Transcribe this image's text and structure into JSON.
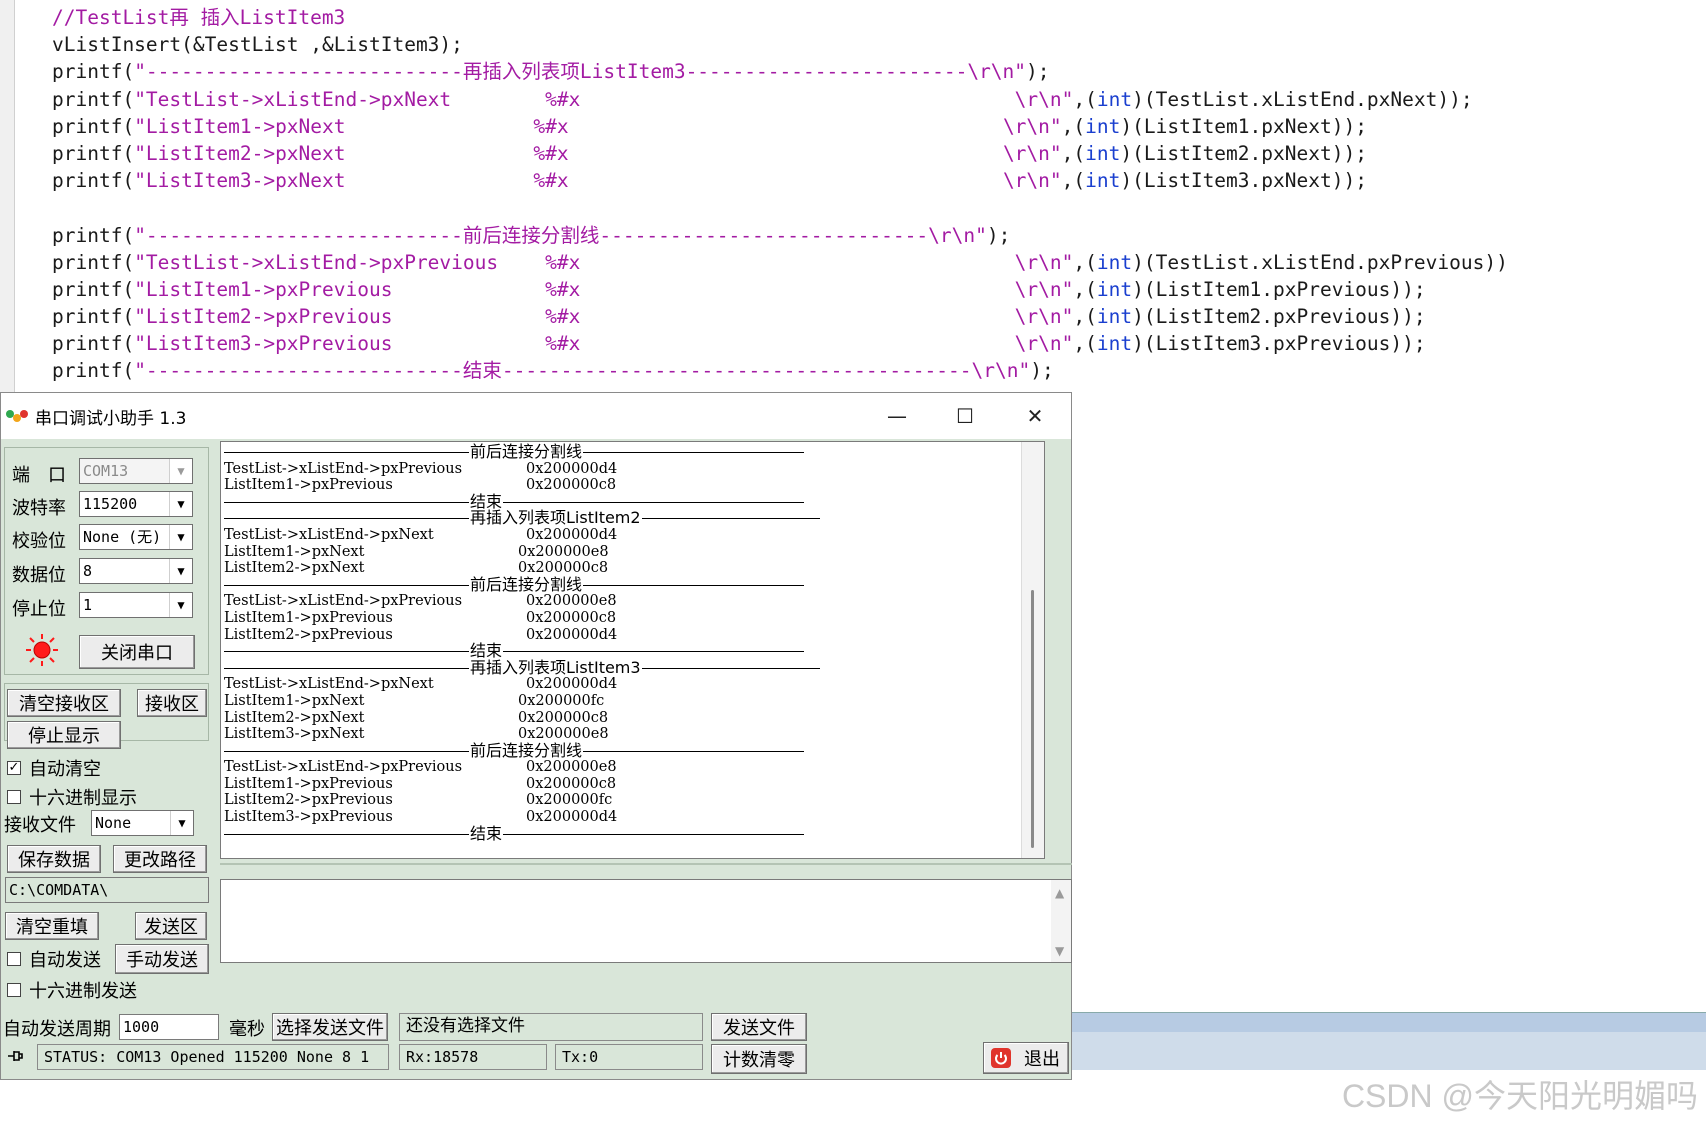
{
  "editor": {
    "lines": [
      {
        "parts": [
          {
            "c": "cm",
            "t": "//TestList再 插入ListItem3"
          }
        ]
      },
      {
        "parts": [
          {
            "c": "",
            "t": "vListInsert(&TestList ,&ListItem3);"
          }
        ]
      },
      {
        "parts": [
          {
            "c": "",
            "t": "printf("
          },
          {
            "c": "str",
            "t": "\"---------------------------再插入列表项ListItem3------------------------\\r\\n\""
          },
          {
            "c": "",
            "t": ");"
          }
        ]
      },
      {
        "parts": [
          {
            "c": "",
            "t": "printf("
          },
          {
            "c": "str",
            "t": "\"TestList->xListEnd->pxNext        %#x                                     \\r\\n\""
          },
          {
            "c": "",
            "t": ","
          },
          {
            "c": "",
            "t": "("
          },
          {
            "c": "kw",
            "t": "int"
          },
          {
            "c": "",
            "t": ")(TestList.xListEnd.pxNext));"
          }
        ]
      },
      {
        "parts": [
          {
            "c": "",
            "t": "printf("
          },
          {
            "c": "str",
            "t": "\"ListItem1->pxNext                %#x                                     \\r\\n\""
          },
          {
            "c": "",
            "t": ","
          },
          {
            "c": "",
            "t": "("
          },
          {
            "c": "kw",
            "t": "int"
          },
          {
            "c": "",
            "t": ")(ListItem1.pxNext));"
          }
        ]
      },
      {
        "parts": [
          {
            "c": "",
            "t": "printf("
          },
          {
            "c": "str",
            "t": "\"ListItem2->pxNext                %#x                                     \\r\\n\""
          },
          {
            "c": "",
            "t": ","
          },
          {
            "c": "",
            "t": "("
          },
          {
            "c": "kw",
            "t": "int"
          },
          {
            "c": "",
            "t": ")(ListItem2.pxNext));"
          }
        ]
      },
      {
        "parts": [
          {
            "c": "",
            "t": "printf("
          },
          {
            "c": "str",
            "t": "\"ListItem3->pxNext                %#x                                     \\r\\n\""
          },
          {
            "c": "",
            "t": ","
          },
          {
            "c": "",
            "t": "("
          },
          {
            "c": "kw",
            "t": "int"
          },
          {
            "c": "",
            "t": ")(ListItem3.pxNext));"
          }
        ]
      },
      {
        "parts": []
      },
      {
        "parts": [
          {
            "c": "",
            "t": "printf("
          },
          {
            "c": "str",
            "t": "\"---------------------------前后连接分割线----------------------------\\r\\n\""
          },
          {
            "c": "",
            "t": ");"
          }
        ]
      },
      {
        "parts": [
          {
            "c": "",
            "t": "printf("
          },
          {
            "c": "str",
            "t": "\"TestList->xListEnd->pxPrevious    %#x                                     \\r\\n\""
          },
          {
            "c": "",
            "t": ","
          },
          {
            "c": "",
            "t": "("
          },
          {
            "c": "kw",
            "t": "int"
          },
          {
            "c": "",
            "t": ")(TestList.xListEnd.pxPrevious))"
          }
        ]
      },
      {
        "parts": [
          {
            "c": "",
            "t": "printf("
          },
          {
            "c": "str",
            "t": "\"ListItem1->pxPrevious             %#x                                     \\r\\n\""
          },
          {
            "c": "",
            "t": ","
          },
          {
            "c": "",
            "t": "("
          },
          {
            "c": "kw",
            "t": "int"
          },
          {
            "c": "",
            "t": ")(ListItem1.pxPrevious));"
          }
        ]
      },
      {
        "parts": [
          {
            "c": "",
            "t": "printf("
          },
          {
            "c": "str",
            "t": "\"ListItem2->pxPrevious             %#x                                     \\r\\n\""
          },
          {
            "c": "",
            "t": ","
          },
          {
            "c": "",
            "t": "("
          },
          {
            "c": "kw",
            "t": "int"
          },
          {
            "c": "",
            "t": ")(ListItem2.pxPrevious));"
          }
        ]
      },
      {
        "parts": [
          {
            "c": "",
            "t": "printf("
          },
          {
            "c": "str",
            "t": "\"ListItem3->pxPrevious             %#x                                     \\r\\n\""
          },
          {
            "c": "",
            "t": ","
          },
          {
            "c": "",
            "t": "("
          },
          {
            "c": "kw",
            "t": "int"
          },
          {
            "c": "",
            "t": ")(ListItem3.pxPrevious));"
          }
        ]
      },
      {
        "parts": [
          {
            "c": "",
            "t": "printf("
          },
          {
            "c": "str",
            "t": "\"---------------------------结束----------------------------------------\\r\\n\""
          },
          {
            "c": "",
            "t": ");"
          }
        ]
      }
    ]
  },
  "window": {
    "title": "串口调试小助手 1.3",
    "minimize": "—",
    "maximize": "☐",
    "close": "✕"
  },
  "settings": {
    "port_label": "端　口",
    "port_value": "COM13",
    "baud_label": "波特率",
    "baud_value": "115200",
    "parity_label": "校验位",
    "parity_value": "None (无)",
    "databits_label": "数据位",
    "databits_value": "8",
    "stopbits_label": "停止位",
    "stopbits_value": "1",
    "close_port": "关闭串口"
  },
  "receive_controls": {
    "clear_receive": "清空接收区",
    "receive_area_label": "接收区",
    "stop_display": "停止显示",
    "auto_clear": "自动清空",
    "auto_clear_checked": "✓",
    "hex_display": "十六进制显示",
    "receive_file_label": "接收文件",
    "receive_file_value": "None",
    "save_data": "保存数据",
    "change_path": "更改路径",
    "path": "C:\\COMDATA\\"
  },
  "send_controls": {
    "clear_refill": "清空重填",
    "send_area_label": "发送区",
    "auto_send": "自动发送",
    "manual_send": "手动发送",
    "hex_send": "十六进制发送",
    "period_label": "自动发送周期",
    "period_value": "1000",
    "ms_label": "毫秒",
    "choose_file": "选择发送文件",
    "file_status": "还没有选择文件",
    "send_file": "发送文件",
    "reset_count": "计数清零",
    "exit": "退出"
  },
  "status": {
    "status_text": "STATUS: COM13 Opened 115200 None  8 1",
    "rx": "Rx:18578",
    "tx": "Tx:0"
  },
  "receive_log": [
    {
      "type": "div",
      "cap": "前后连接分割线",
      "w": 580
    },
    {
      "type": "row",
      "name": "TestList->xListEnd->pxPrevious",
      "val": "0x200000d4"
    },
    {
      "type": "row",
      "name": "ListItem1->pxPrevious",
      "val": "0x200000c8"
    },
    {
      "type": "div",
      "cap": "结束",
      "w": 580
    },
    {
      "type": "div",
      "cap": "再插入列表项ListItem2",
      "w": 596
    },
    {
      "type": "row",
      "name": "TestList->xListEnd->pxNext",
      "val": "0x200000d4"
    },
    {
      "type": "row",
      "name": "ListItem1->pxNext",
      "val": "0x200000e8",
      "alt": true
    },
    {
      "type": "row",
      "name": "ListItem2->pxNext",
      "val": "0x200000c8",
      "alt": true
    },
    {
      "type": "div",
      "cap": "前后连接分割线",
      "w": 580
    },
    {
      "type": "row",
      "name": "TestList->xListEnd->pxPrevious",
      "val": "0x200000e8"
    },
    {
      "type": "row",
      "name": "ListItem1->pxPrevious",
      "val": "0x200000c8"
    },
    {
      "type": "row",
      "name": "ListItem2->pxPrevious",
      "val": "0x200000d4"
    },
    {
      "type": "div",
      "cap": "结束",
      "w": 580
    },
    {
      "type": "div",
      "cap": "再插入列表项ListItem3",
      "w": 596
    },
    {
      "type": "row",
      "name": "TestList->xListEnd->pxNext",
      "val": "0x200000d4"
    },
    {
      "type": "row",
      "name": "ListItem1->pxNext",
      "val": "0x200000fc",
      "alt": true
    },
    {
      "type": "row",
      "name": "ListItem2->pxNext",
      "val": "0x200000c8",
      "alt": true
    },
    {
      "type": "row",
      "name": "ListItem3->pxNext",
      "val": "0x200000e8",
      "alt": true
    },
    {
      "type": "div",
      "cap": "前后连接分割线",
      "w": 580
    },
    {
      "type": "row",
      "name": "TestList->xListEnd->pxPrevious",
      "val": "0x200000e8"
    },
    {
      "type": "row",
      "name": "ListItem1->pxPrevious",
      "val": "0x200000c8"
    },
    {
      "type": "row",
      "name": "ListItem2->pxPrevious",
      "val": "0x200000fc"
    },
    {
      "type": "row",
      "name": "ListItem3->pxPrevious",
      "val": "0x200000d4"
    },
    {
      "type": "div",
      "cap": "结束",
      "w": 580
    }
  ],
  "watermark": "CSDN @今天阳光明媚吗",
  "colors": {
    "code_string": "#a31ba3",
    "code_keyword": "#1a3fcf",
    "panel_bg": "#d9e6d9",
    "led_red": "#ff1a1a"
  }
}
